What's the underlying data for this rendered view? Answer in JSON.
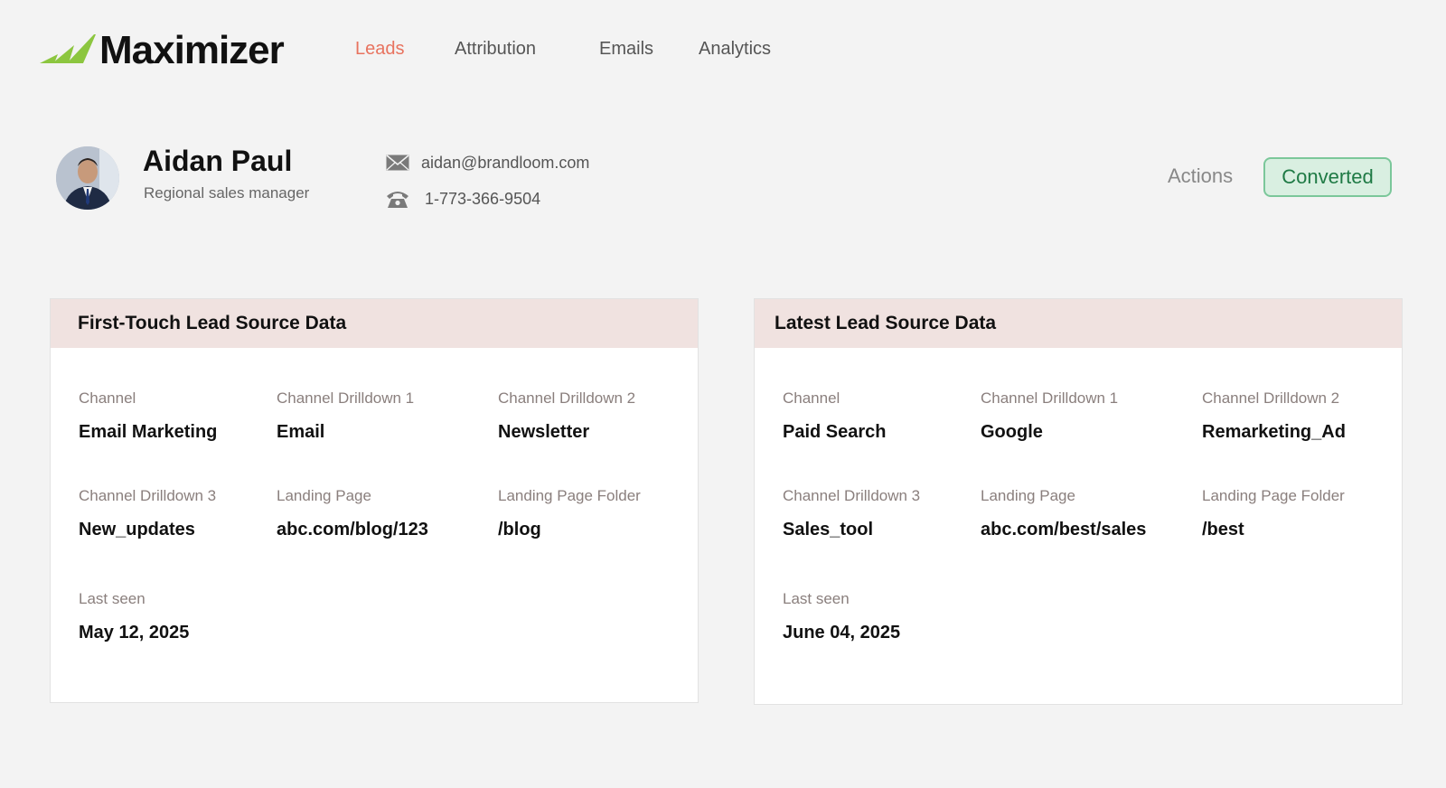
{
  "app": {
    "brand": "Maximizer",
    "accent": "#e8735f",
    "brand_green": "#8cc63f"
  },
  "nav": {
    "items": [
      {
        "label": "Leads",
        "active": true
      },
      {
        "label": "Attribution",
        "active": false
      },
      {
        "label": "Emails",
        "active": false
      },
      {
        "label": "Analytics",
        "active": false
      }
    ]
  },
  "profile": {
    "name": "Aidan Paul",
    "role": "Regional sales manager",
    "email": "aidan@brandloom.com",
    "phone": "1-773-366-9504",
    "email_icon": "envelope-icon",
    "phone_icon": "telephone-icon"
  },
  "header_actions": {
    "actions_label": "Actions",
    "status": "Converted",
    "status_color": "#1f7a45"
  },
  "first_touch": {
    "title": "First-Touch Lead Source Data",
    "fields": [
      {
        "label": "Channel",
        "value": "Email Marketing"
      },
      {
        "label": "Channel Drilldown 1",
        "value": "Email"
      },
      {
        "label": "Channel Drilldown 2",
        "value": "Newsletter"
      },
      {
        "label": "Channel Drilldown 3",
        "value": "New_updates"
      },
      {
        "label": "Landing Page",
        "value": "abc.com/blog/123"
      },
      {
        "label": "Landing Page Folder",
        "value": "/blog"
      },
      {
        "label": "Last seen",
        "value": "May 12, 2025"
      }
    ]
  },
  "latest": {
    "title": "Latest Lead Source Data",
    "fields": [
      {
        "label": "Channel",
        "value": "Paid Search"
      },
      {
        "label": "Channel Drilldown 1",
        "value": "Google"
      },
      {
        "label": "Channel Drilldown 2",
        "value": "Remarketing_Ad"
      },
      {
        "label": "Channel Drilldown 3",
        "value": "Sales_tool"
      },
      {
        "label": "Landing Page",
        "value": "abc.com/best/sales"
      },
      {
        "label": "Landing Page Folder",
        "value": "/best"
      },
      {
        "label": "Last seen",
        "value": "June 04, 2025"
      }
    ]
  }
}
